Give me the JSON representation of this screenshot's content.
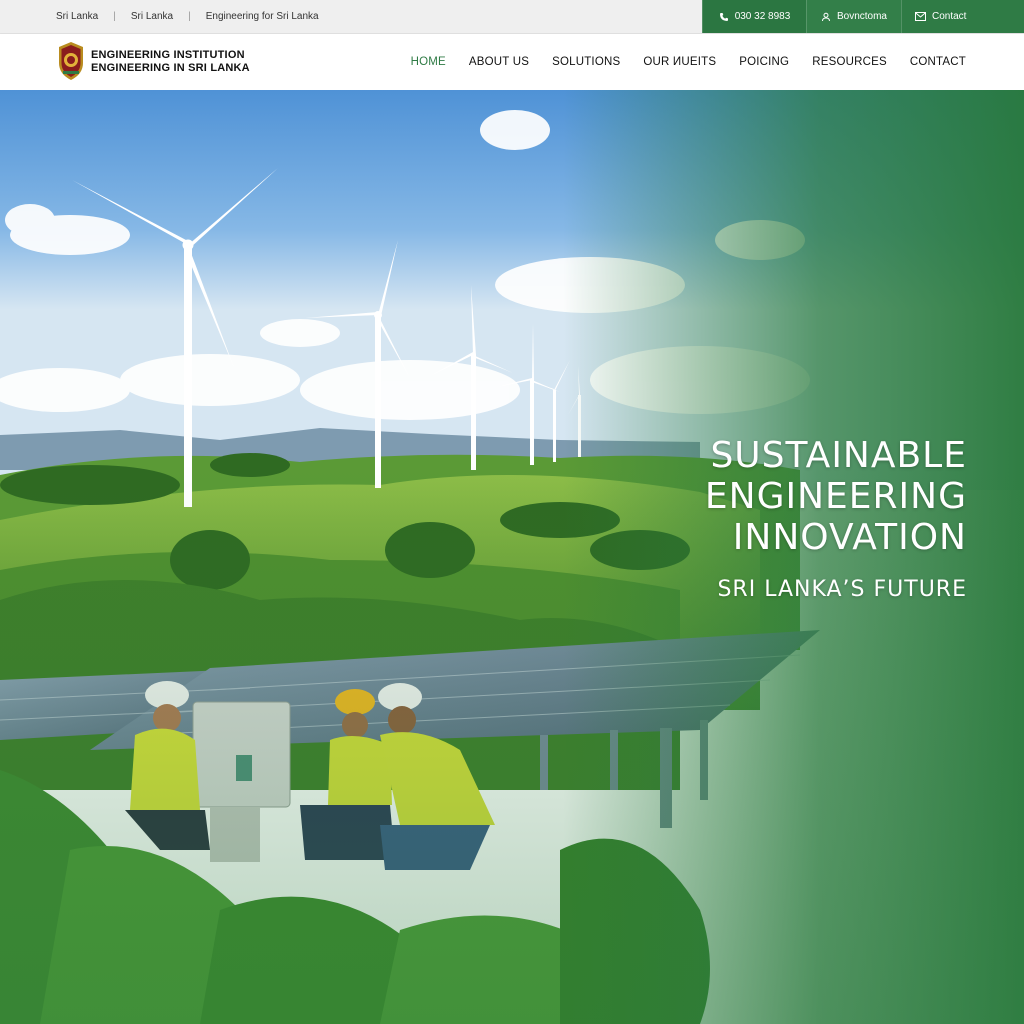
{
  "topbar": {
    "links": [
      "Sri Lanka",
      "Sri Lanka",
      "Engineering for Sri Lanka"
    ],
    "phone": "030 32 8983",
    "phone_icon": "phone-icon",
    "book": "Bovnctoma",
    "book_icon": "user-icon",
    "contact": "Contact",
    "contact_icon": "mail-icon"
  },
  "header": {
    "org_line1": "ENGINEERING INSTITUTION",
    "org_line2": "ENGINEERING IN SRI LANKA",
    "logo_icon": "crest-emblem-icon",
    "nav": [
      "HOME",
      "ABOUT US",
      "SOLUTIONS",
      "OUR ИUEITS",
      "POICING",
      "RESOURCES",
      "CONTACT"
    ],
    "active_nav": "HOME"
  },
  "hero": {
    "title_lines": [
      "SUSTAINABLE",
      "ENGINEERING",
      "INNOVATION"
    ],
    "subtitle": "SRI LANKA’S FUTURE"
  },
  "colors": {
    "brand_green": "#2f7b45",
    "topbar_bg": "#efefef"
  }
}
